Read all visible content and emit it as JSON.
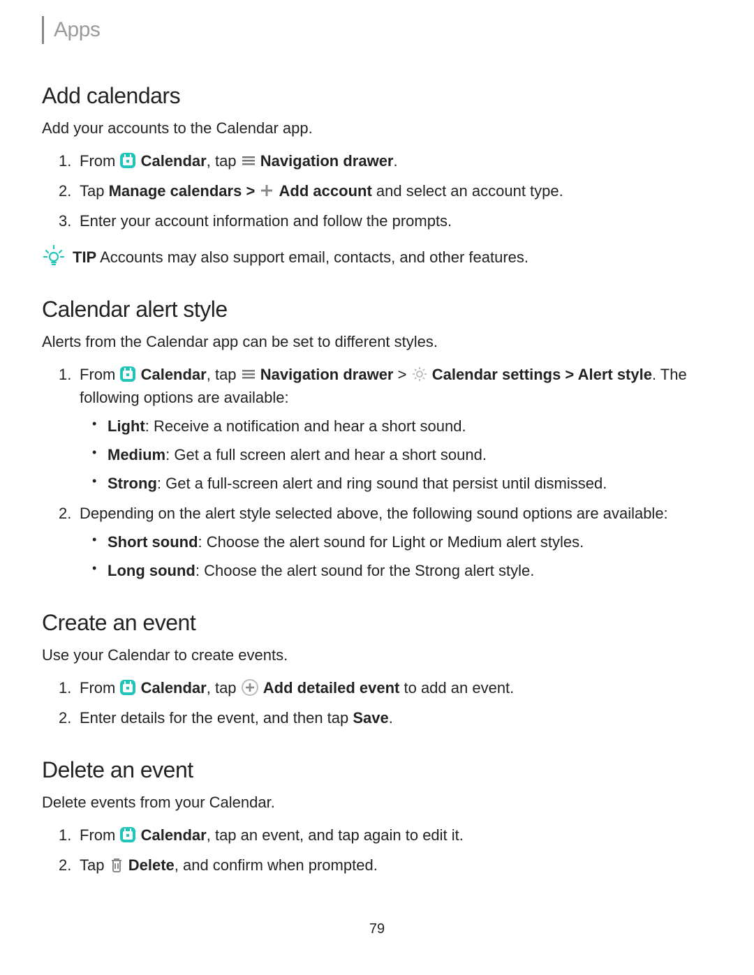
{
  "page": {
    "header": "Apps",
    "number": "79"
  },
  "sections": {
    "add": {
      "title": "Add calendars",
      "desc": "Add your accounts to the Calendar app.",
      "s1_from": "From ",
      "s1_cal": "Calendar",
      "s1_tap": ", tap ",
      "s1_nav": "Navigation drawer",
      "s1_period": ".",
      "s2_tap": "Tap ",
      "s2_mc": "Manage calendars > ",
      "s2_aa": "Add account",
      "s2_rest": " and select an account type.",
      "s3": "Enter your account information and follow the prompts.",
      "tip_label": "TIP",
      "tip_text": "  Accounts may also support email, contacts, and other features."
    },
    "alert": {
      "title": "Calendar alert style",
      "desc": "Alerts from the Calendar app can be set to different styles.",
      "s1_from": "From ",
      "s1_cal": "Calendar",
      "s1_tap": ", tap ",
      "s1_nav": "Navigation drawer",
      "s1_gt1": " > ",
      "s1_cs": "Calendar settings",
      "s1_gt2": " > ",
      "s1_as": "Alert style",
      "s1_period": ". ",
      "s1_follow": "The following options are available:",
      "opt_light_b": "Light",
      "opt_light": ": Receive a notification and hear a short sound.",
      "opt_med_b": "Medium",
      "opt_med": ": Get a full screen alert and hear a short sound.",
      "opt_strong_b": "Strong",
      "opt_strong": ": Get a full-screen alert and ring sound that persist until dismissed.",
      "s2": "Depending on the alert style selected above, the following sound options are available:",
      "opt_short_b": "Short sound",
      "opt_short": ": Choose the alert sound for Light or Medium alert styles.",
      "opt_long_b": "Long sound",
      "opt_long": ": Choose the alert sound for the Strong alert style."
    },
    "create": {
      "title": "Create an event",
      "desc": "Use your Calendar to create events.",
      "s1_from": "From ",
      "s1_cal": "Calendar",
      "s1_tap": ", tap ",
      "s1_ade": "Add detailed event",
      "s1_rest": " to add an event.",
      "s2_a": "Enter details for the event, and then tap ",
      "s2_save": "Save",
      "s2_period": "."
    },
    "del": {
      "title": "Delete an event",
      "desc": "Delete events from your Calendar.",
      "s1_from": "From ",
      "s1_cal": "Calendar",
      "s1_rest": ", tap an event, and tap again to edit it.",
      "s2_tap": "Tap ",
      "s2_del": "Delete",
      "s2_rest": ", and confirm when prompted."
    }
  }
}
